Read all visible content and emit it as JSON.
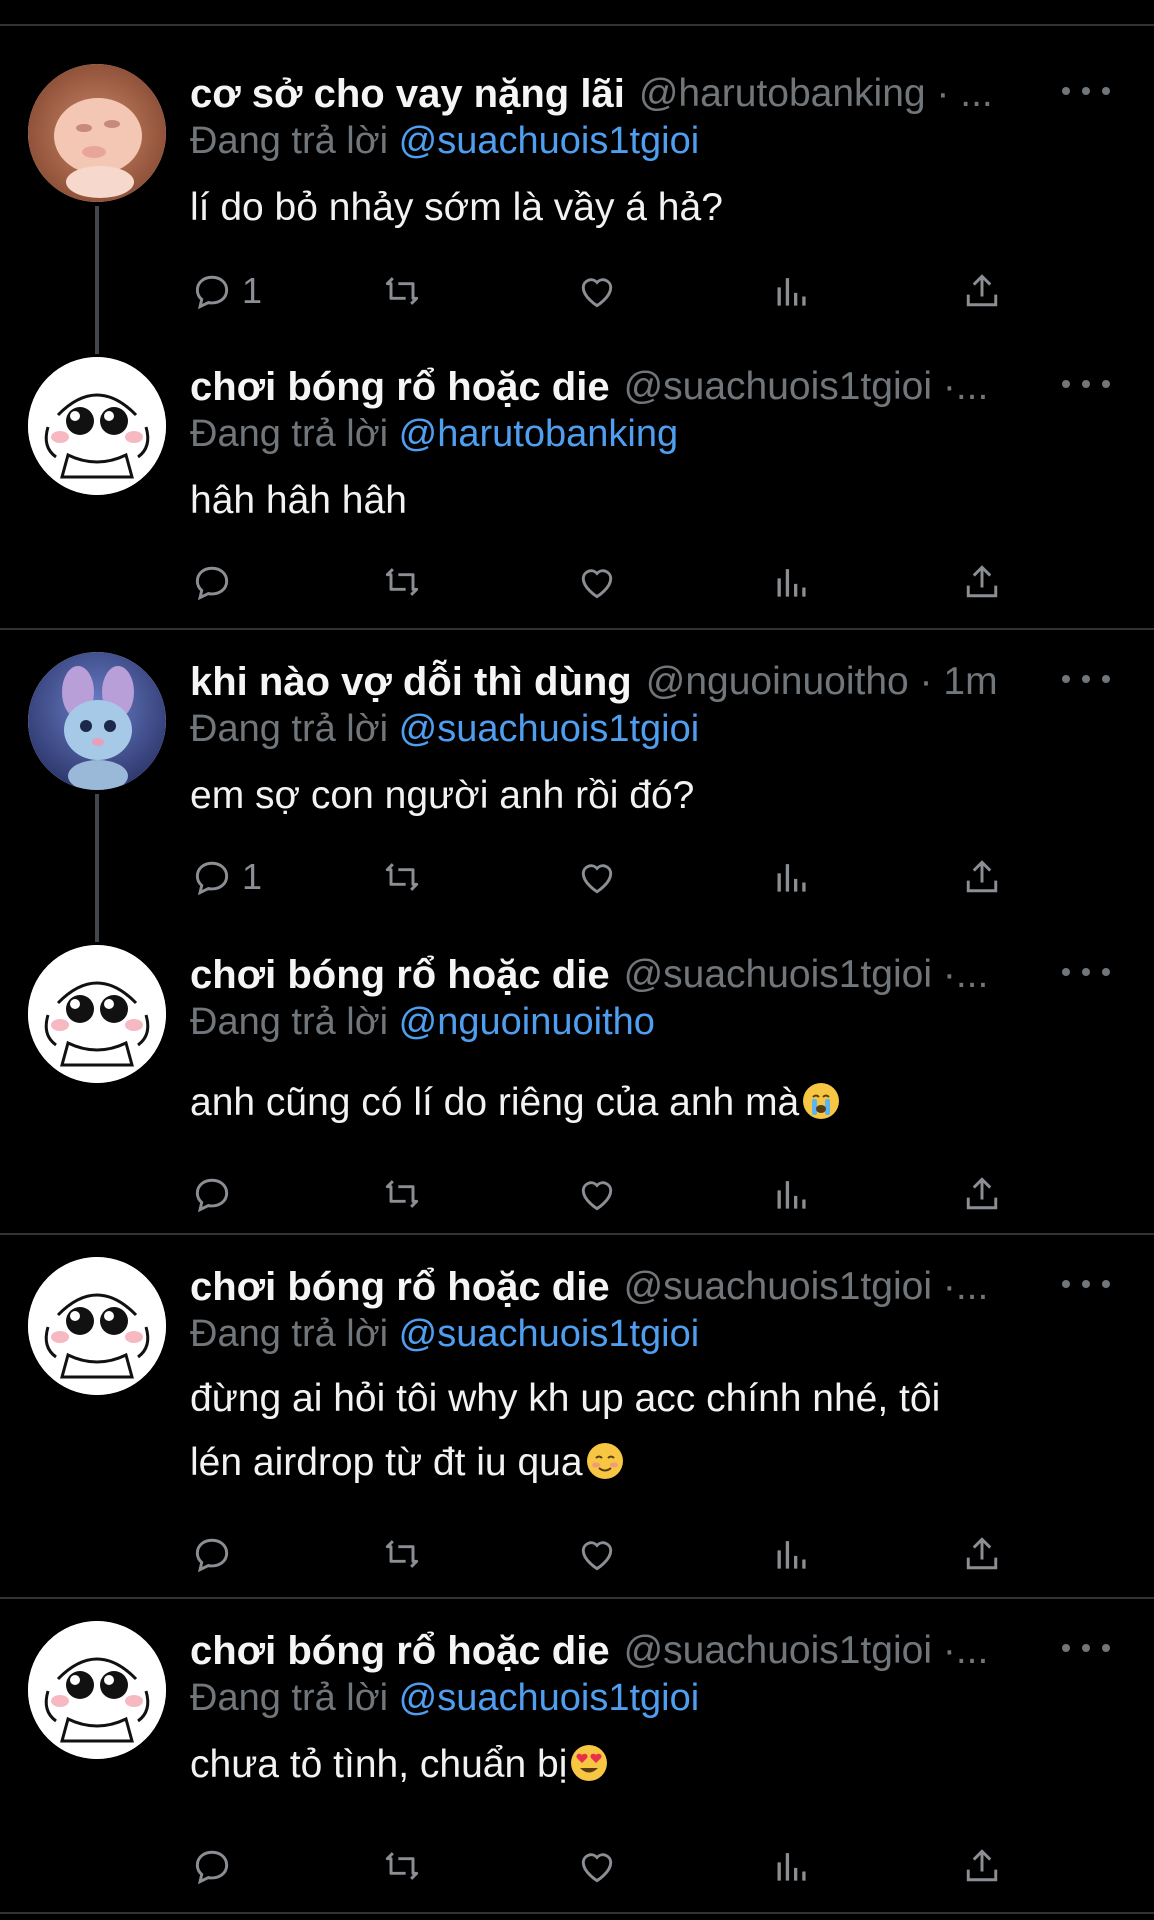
{
  "tweets": [
    {
      "name": "cơ sở cho vay nặng lãi",
      "handle": "@harutobanking · ...",
      "reply_prefix": "Đang trả lời",
      "reply_to": "@suachuois1tgioi",
      "text_lines": [
        "lí do bỏ nhảy sớm là vầy á hả?"
      ],
      "reply_count": "1",
      "avatar": "baby-face-avatar"
    },
    {
      "name": "chơi bóng rổ hoặc die",
      "handle": "@suachuois1tgioi ·...",
      "reply_prefix": "Đang trả lời",
      "reply_to": "@harutobanking",
      "text_lines": [
        "hâh hâh hâh"
      ],
      "reply_count": "",
      "avatar": "cartoon-face-avatar"
    },
    {
      "name": "khi nào vợ dỗi thì dùng",
      "handle": "@nguoinuoitho · 1m",
      "reply_prefix": "Đang trả lời",
      "reply_to": "@suachuois1tgioi",
      "text_lines": [
        "em sợ con người anh rồi đó?"
      ],
      "reply_count": "1",
      "avatar": "bunny-avatar"
    },
    {
      "name": "chơi bóng rổ hoặc die",
      "handle": "@suachuois1tgioi ·...",
      "reply_prefix": "Đang trả lời",
      "reply_to": "@nguoinuoitho",
      "text_lines": [
        "anh cũng có lí do riêng của anh mà"
      ],
      "emoji": "crying-face-emoji",
      "reply_count": "",
      "avatar": "cartoon-face-avatar"
    },
    {
      "name": "chơi bóng rổ hoặc die",
      "handle": "@suachuois1tgioi ·...",
      "reply_prefix": "Đang trả lời",
      "reply_to": "@suachuois1tgioi",
      "text_lines": [
        "đừng ai hỏi tôi why kh up acc chính nhé, tôi",
        "lén airdrop từ đt iu qua"
      ],
      "emoji": "smiling-blush-emoji",
      "reply_count": "",
      "avatar": "cartoon-face-avatar"
    },
    {
      "name": "chơi bóng rổ hoặc die",
      "handle": "@suachuois1tgioi ·...",
      "reply_prefix": "Đang trả lời",
      "reply_to": "@suachuois1tgioi",
      "text_lines": [
        "chưa tỏ tình, chuẩn bị"
      ],
      "emoji": "heart-eyes-emoji",
      "reply_count": "",
      "avatar": "cartoon-face-avatar"
    }
  ],
  "actions": [
    "reply-icon",
    "retweet-icon",
    "like-icon",
    "views-icon",
    "share-icon"
  ],
  "colors": {
    "background": "#000000",
    "mention": "#4f9ef0",
    "muted": "#71767b",
    "divider": "#2f3336"
  }
}
